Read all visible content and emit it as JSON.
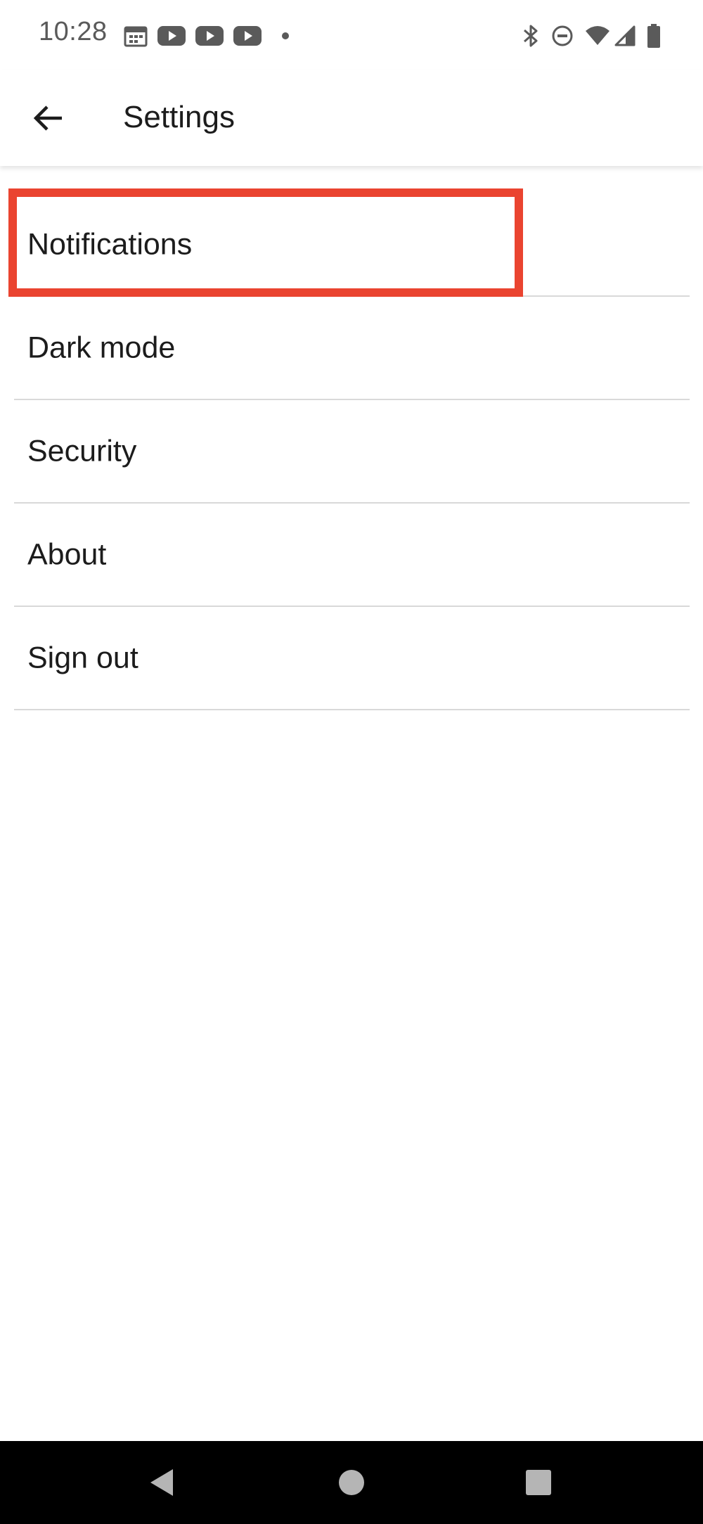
{
  "status_bar": {
    "time": "10:28",
    "left_icons": [
      "calendar-icon",
      "youtube-icon",
      "youtube-icon",
      "youtube-icon",
      "dot-icon"
    ],
    "right_icons": [
      "bluetooth-icon",
      "do-not-disturb-icon",
      "wifi-icon",
      "cell-signal-icon",
      "battery-icon"
    ]
  },
  "app_bar": {
    "back_icon": "arrow-back-icon",
    "title": "Settings"
  },
  "settings": {
    "items": [
      {
        "label": "Notifications"
      },
      {
        "label": "Dark mode"
      },
      {
        "label": "Security"
      },
      {
        "label": "About"
      },
      {
        "label": "Sign out"
      }
    ]
  },
  "highlight": {
    "color": "#ea4430",
    "target": "Notifications"
  },
  "nav_bar": {
    "buttons": [
      "back-triangle-icon",
      "home-circle-icon",
      "recents-square-icon"
    ]
  }
}
